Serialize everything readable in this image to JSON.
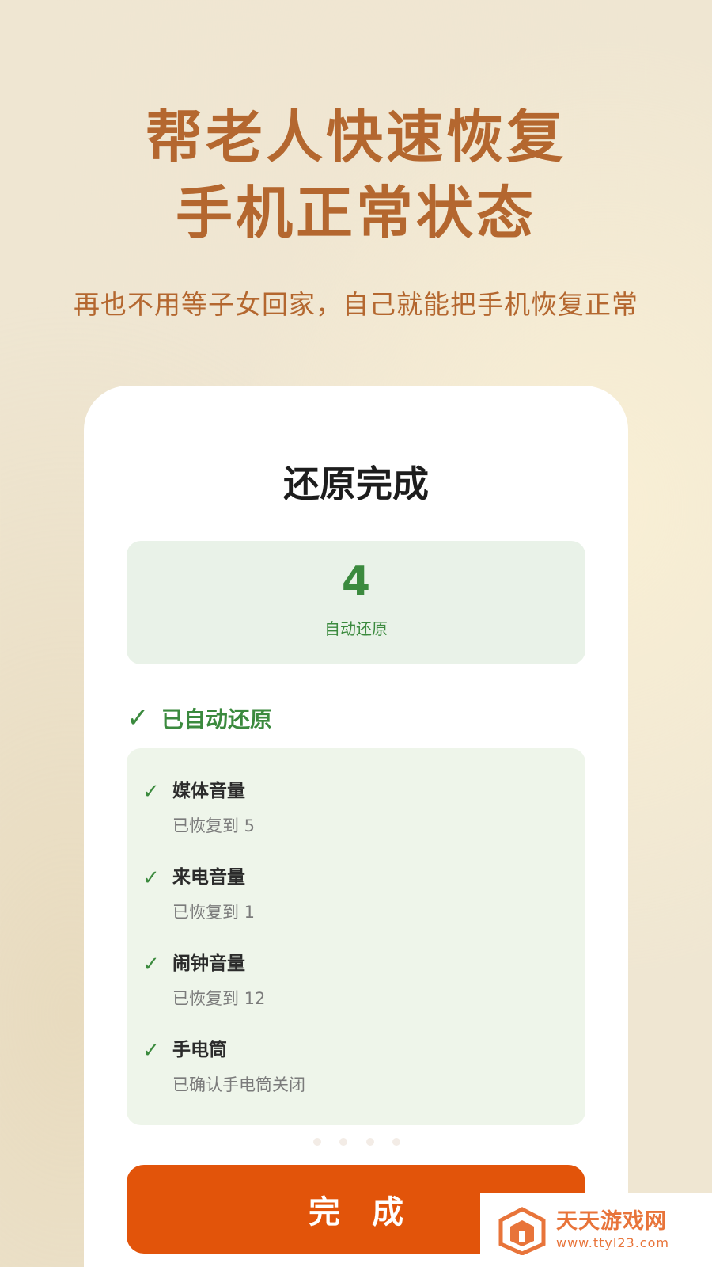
{
  "hero": {
    "title_line1": "帮老人快速恢复",
    "title_line2": "手机正常状态",
    "subtitle": "再也不用等子女回家，自己就能把手机恢复正常"
  },
  "card": {
    "title": "还原完成",
    "stat": {
      "number": "4",
      "label": "自动还原"
    },
    "section": {
      "check": "✓",
      "label": "已自动还原"
    },
    "items": [
      {
        "check": "✓",
        "name": "媒体音量",
        "desc": "已恢复到 5"
      },
      {
        "check": "✓",
        "name": "来电音量",
        "desc": "已恢复到 1"
      },
      {
        "check": "✓",
        "name": "闹钟音量",
        "desc": "已恢复到 12"
      },
      {
        "check": "✓",
        "name": "手电筒",
        "desc": "已确认手电筒关闭"
      }
    ],
    "done_button": "完成",
    "pager_count": 4
  },
  "watermark": {
    "name": "天天游戏网",
    "url": "www.ttyl23.com"
  },
  "colors": {
    "accent_title": "#b4672f",
    "green": "#3b8a3e",
    "button": "#e2540a",
    "watermark": "#e8743a"
  },
  "icons": {
    "check": "check-icon",
    "logo": "house-logo-icon"
  }
}
